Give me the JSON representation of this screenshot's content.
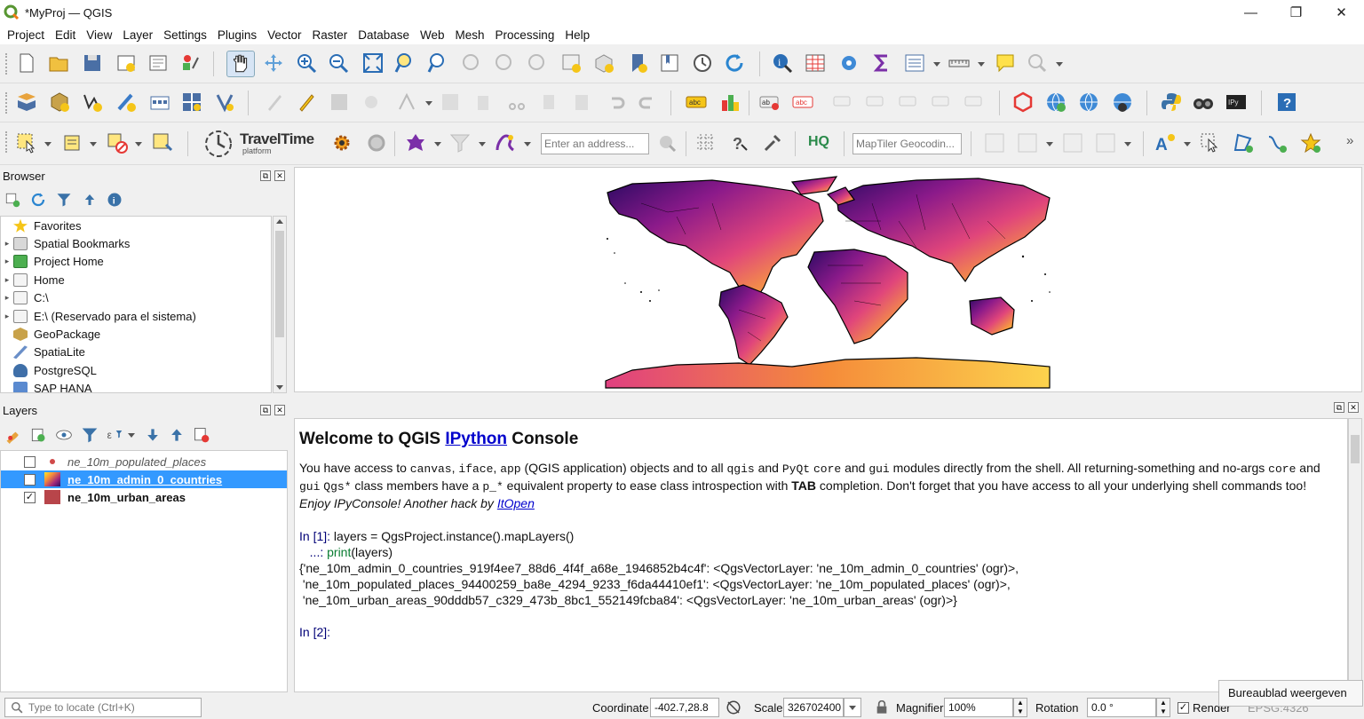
{
  "window": {
    "title": "*MyProj — QGIS",
    "min": "—",
    "max": "❐",
    "close": "✕"
  },
  "menu": [
    "Project",
    "Edit",
    "View",
    "Layer",
    "Settings",
    "Plugins",
    "Vector",
    "Raster",
    "Database",
    "Web",
    "Mesh",
    "Processing",
    "Help"
  ],
  "toolbar3": {
    "address_placeholder": "Enter an address...",
    "maptiler_placeholder": "MapTiler Geocodin...",
    "traveltime_title": "TravelTime",
    "traveltime_sub": "platform",
    "hq_label": "HQ",
    "more": "»"
  },
  "browser": {
    "title": "Browser",
    "items": [
      {
        "label": "Favorites",
        "arrow": "",
        "icon": "#f5c518"
      },
      {
        "label": "Spatial Bookmarks",
        "arrow": "▸",
        "icon": "#cfcfcf"
      },
      {
        "label": "Project Home",
        "arrow": "▸",
        "icon": "#4caf50"
      },
      {
        "label": "Home",
        "arrow": "▸",
        "icon": "#e0e0e0"
      },
      {
        "label": "C:\\",
        "arrow": "▸",
        "icon": "#e8e8e8"
      },
      {
        "label": "E:\\ (Reservado para el sistema)",
        "arrow": "▸",
        "icon": "#e8e8e8"
      },
      {
        "label": "GeoPackage",
        "arrow": "",
        "icon": "#c8a24a"
      },
      {
        "label": "SpatiaLite",
        "arrow": "",
        "icon": "#6a8fc8"
      },
      {
        "label": "PostgreSQL",
        "arrow": "",
        "icon": "#3f6fa8"
      },
      {
        "label": "SAP HANA",
        "arrow": "",
        "icon": "#5a8ad0"
      }
    ]
  },
  "layers": {
    "title": "Layers",
    "items": [
      {
        "name": "ne_10m_populated_places",
        "checked": false,
        "selected": false
      },
      {
        "name": "ne_10m_admin_0_countries",
        "checked": true,
        "selected": true
      },
      {
        "name": "ne_10m_urban_areas",
        "checked": true,
        "selected": false
      }
    ]
  },
  "console": {
    "heading_pre": "Welcome to QGIS ",
    "heading_link": "IPython",
    "heading_post": " Console",
    "intro": [
      {
        "t": "You have access to ",
        "m": false
      },
      {
        "t": "canvas",
        "m": true
      },
      {
        "t": ", ",
        "m": false
      },
      {
        "t": "iface",
        "m": true
      },
      {
        "t": ", ",
        "m": false
      },
      {
        "t": "app",
        "m": true
      },
      {
        "t": " (QGIS application) objects and to all ",
        "m": false
      },
      {
        "t": "qgis",
        "m": true
      },
      {
        "t": " and ",
        "m": false
      },
      {
        "t": "PyQt",
        "m": true
      },
      {
        "t": " ",
        "m": false
      },
      {
        "t": "core",
        "m": true
      },
      {
        "t": " and ",
        "m": false
      },
      {
        "t": "gui",
        "m": true
      },
      {
        "t": " modules directly from the shell. All returning-something and no-args ",
        "m": false
      },
      {
        "t": "core",
        "m": true
      },
      {
        "t": " and ",
        "m": false
      },
      {
        "t": "gui",
        "m": true
      },
      {
        "t": " ",
        "m": false
      },
      {
        "t": "Qgs*",
        "m": true
      },
      {
        "t": " class members have a ",
        "m": false
      },
      {
        "t": "p_*",
        "m": true
      },
      {
        "t": " equivalent property to ease class introspection with ",
        "m": false
      },
      {
        "t": "TAB",
        "m": false,
        "b": true
      },
      {
        "t": " completion. Don't forget that you have access to all your underlying shell commands too!",
        "m": false
      }
    ],
    "enjoy": "Enjoy IPyConsole! Another hack by ",
    "enjoy_link": "ItOpen",
    "in1_prompt": "In [1]: ",
    "in1_code": "layers = QgsProject.instance().mapLayers()",
    "in1_cont_prompt": "   ...: ",
    "in1_cont_fn": "print",
    "in1_cont_rest": "(layers)",
    "output": [
      "{'ne_10m_admin_0_countries_919f4ee7_88d6_4f4f_a68e_1946852b4c4f': <QgsVectorLayer: 'ne_10m_admin_0_countries' (ogr)>,",
      " 'ne_10m_populated_places_94400259_ba8e_4294_9233_f6da44410ef1': <QgsVectorLayer: 'ne_10m_populated_places' (ogr)>,",
      " 'ne_10m_urban_areas_90dddb57_c329_473b_8bc1_552149fcba84': <QgsVectorLayer: 'ne_10m_urban_areas' (ogr)>}"
    ],
    "in2_prompt": "In [2]: "
  },
  "status": {
    "locate_placeholder": "Type to locate (Ctrl+K)",
    "coordinate_label": "Coordinate",
    "coordinate_value": "-402.7,28.8",
    "scale_label": "Scale",
    "scale_value": "326702400",
    "magnifier_label": "Magnifier",
    "magnifier_value": "100%",
    "rotation_label": "Rotation",
    "rotation_value": "0.0 °",
    "render_label": "Render",
    "crs": "EPSG:4326",
    "tooltip": "Bureaublad weergeven"
  }
}
